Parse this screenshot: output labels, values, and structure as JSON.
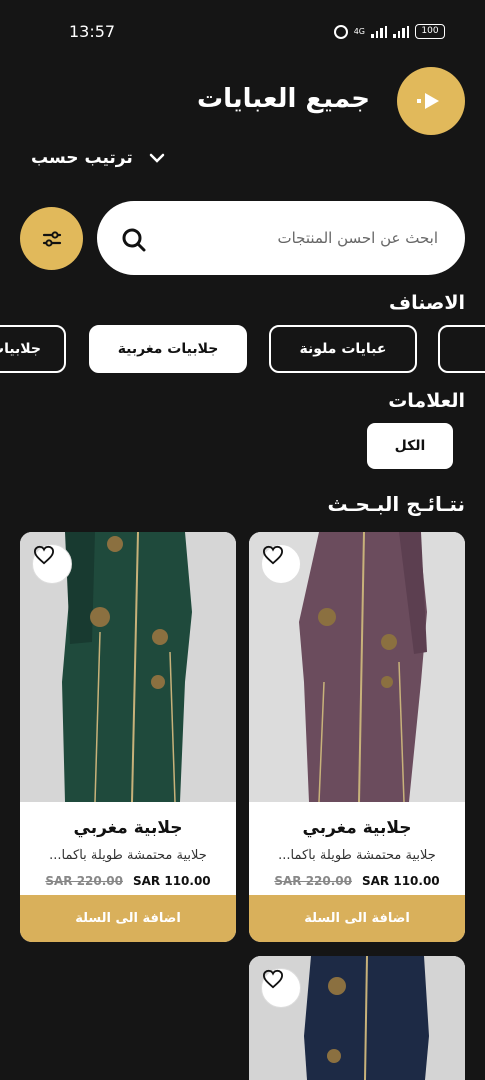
{
  "status_bar": {
    "time": "13:57",
    "network": "4G",
    "battery": "100"
  },
  "header": {
    "title": "جميع العبايات",
    "sort_label": "ترتيب حسب",
    "logo_icon": "play-arrow-logo-icon"
  },
  "search": {
    "placeholder": "ابحث عن احسن المنتجات"
  },
  "categories": {
    "title": "الاصناف",
    "items": [
      {
        "label": ""
      },
      {
        "label": "عبايات ملونة"
      },
      {
        "label": "جلابيات مغربية"
      },
      {
        "label": "جلابيات"
      }
    ]
  },
  "brands": {
    "title": "العلامات",
    "items": [
      {
        "label": "الكل"
      }
    ]
  },
  "results": {
    "title": "نتـائـج البـحـث",
    "products": [
      {
        "name": "جلابية مغربي",
        "description": "جلابية محتمشة طويلة بأكما...",
        "old_price": "SAR 220.00",
        "new_price": "SAR 110.00",
        "cta": "اضافة الى السلة",
        "color": "#6b4c5d"
      },
      {
        "name": "جلابية مغربي",
        "description": "جلابية محتمشة طويلة بأكما...",
        "old_price": "SAR 220.00",
        "new_price": "SAR 110.00",
        "cta": "اضافة الى السلة",
        "color": "#1f4a3c"
      },
      {
        "name": "",
        "description": "",
        "old_price": "",
        "new_price": "",
        "cta": "",
        "color": "#1d2a45"
      }
    ]
  },
  "colors": {
    "background": "#151515",
    "accent": "#e1b95b",
    "cta": "#d9b05b"
  }
}
